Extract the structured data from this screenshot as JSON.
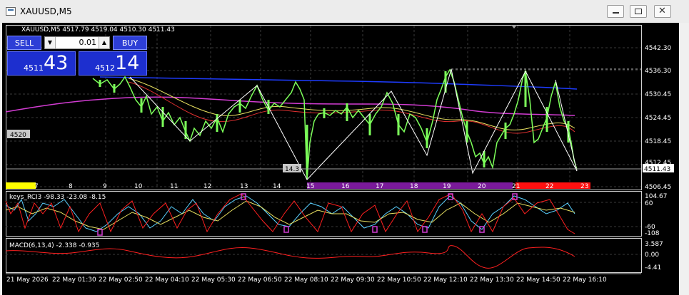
{
  "window": {
    "title": "XAUUSD,M5"
  },
  "chart": {
    "header": "XAUUSD,M5  4517.79 4519.04 4510.30 4511.43",
    "price_axis": [
      "4542.30",
      "4536.30",
      "4530.45",
      "4524.45",
      "4518.45",
      "4512.45",
      "4506.45"
    ],
    "current_price": "4511.43",
    "left_price_label": "4520",
    "spread_label": "14.3",
    "hour_labels": [
      "7",
      "8",
      "9",
      "10",
      "11",
      "12",
      "13",
      "14",
      "15",
      "16",
      "17",
      "18",
      "19",
      "20",
      "21",
      "22",
      "23"
    ],
    "time_axis": [
      "21 May 2026",
      "22 May 01:30",
      "22 May 02:50",
      "22 May 04:10",
      "22 May 05:30",
      "22 May 06:50",
      "22 May 08:10",
      "22 May 09:30",
      "22 May 10:50",
      "22 May 12:10",
      "22 May 13:30",
      "22 May 14:50",
      "22 May 16:10"
    ]
  },
  "trade_panel": {
    "sell_label": "SELL",
    "buy_label": "BUY",
    "lot": "0.01",
    "bid_small": "4511",
    "bid_big": "43",
    "ask_small": "4512",
    "ask_big": "14"
  },
  "indicator1": {
    "label": "keys_RCI3 -98.33 -23.08 -8.15",
    "levels": [
      "104.67",
      "60",
      "-60",
      "-108"
    ]
  },
  "indicator2": {
    "label": "MACD(6,13,4) -2.338 -0.935",
    "levels": [
      "3.587",
      "0.00",
      "-4.41"
    ]
  },
  "colors": {
    "candles": "#7cff5a",
    "price_line": "#a0a0a0",
    "ma_blue": "#1e3cff",
    "ma_magenta": "#d23cd2",
    "hour_band": "#7a1a9a",
    "hour_band_today": "#ff1010",
    "hour_band_start": "#ffff00"
  }
}
